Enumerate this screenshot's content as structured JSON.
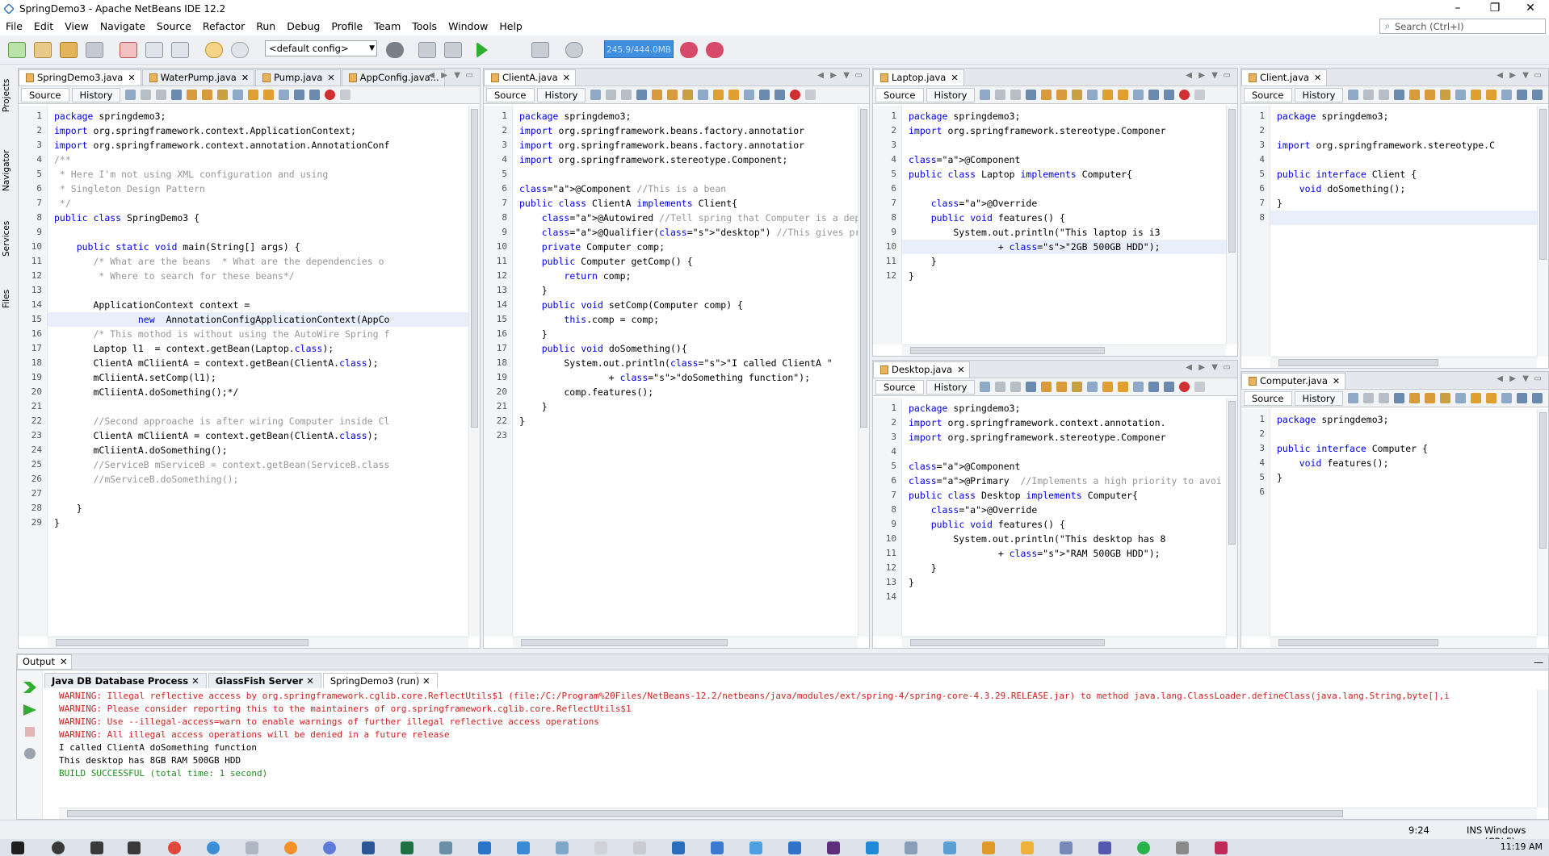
{
  "window": {
    "title": "SpringDemo3 - Apache NetBeans IDE 12.2"
  },
  "menu": [
    "File",
    "Edit",
    "View",
    "Navigate",
    "Source",
    "Refactor",
    "Run",
    "Debug",
    "Profile",
    "Team",
    "Tools",
    "Window",
    "Help"
  ],
  "search": {
    "placeholder": "Search (Ctrl+I)"
  },
  "toolbar": {
    "config": "<default config>",
    "memory": "245.9/444.0MB"
  },
  "side_tabs": [
    "Projects",
    "Navigator",
    "Services",
    "Files"
  ],
  "editor": {
    "source_label": "Source",
    "history_label": "History"
  },
  "panes": {
    "p1": {
      "tabs": [
        "SpringDemo3.java",
        "WaterPump.java",
        "Pump.java",
        "AppConfig.java..."
      ],
      "lines": [
        "1",
        "2",
        "3",
        "4",
        "5",
        "6",
        "7",
        "8",
        "9",
        "10",
        "11",
        "12",
        "13",
        "14",
        "15",
        "16",
        "17",
        "18",
        "19",
        "20",
        "21",
        "22",
        "23",
        "24",
        "25",
        "26",
        "27",
        "28",
        "29"
      ],
      "code": [
        "package springdemo3;",
        "import org.springframework.context.ApplicationContext;",
        "import org.springframework.context.annotation.AnnotationConf",
        "/**",
        " * Here I'm not using XML configuration and using",
        " * Singleton Design Pattern",
        " */",
        "public class SpringDemo3 {",
        "",
        "    public static void main(String[] args) {",
        "       /* What are the beans  * What are the dependencies o",
        "        * Where to search for these beans*/",
        "",
        "       ApplicationContext context =",
        "               new  AnnotationConfigApplicationContext(AppCo",
        "       /* This mothod is without using the AutoWire Spring f",
        "       Laptop l1  = context.getBean(Laptop.class);",
        "       ClientA mCliientA = context.getBean(ClientA.class);",
        "       mCliientA.setComp(l1);",
        "       mCliientA.doSomething();*/",
        "",
        "       //Second approache is after wiring Computer inside Cl",
        "       ClientA mCliientA = context.getBean(ClientA.class);",
        "       mCliientA.doSomething();",
        "       //ServiceB mServiceB = context.getBean(ServiceB.class",
        "       //mServiceB.doSomething();",
        "",
        "    }",
        "}"
      ]
    },
    "p2": {
      "tabs": [
        "ClientA.java"
      ],
      "lines": [
        "1",
        "2",
        "3",
        "4",
        "5",
        "6",
        "7",
        "8",
        "9",
        "10",
        "11",
        "12",
        "13",
        "14",
        "15",
        "16",
        "17",
        "18",
        "19",
        "20",
        "21",
        "22",
        "23"
      ],
      "code": [
        "package springdemo3;",
        "import org.springframework.beans.factory.annotatior",
        "import org.springframework.beans.factory.annotatior",
        "import org.springframework.stereotype.Component;",
        "",
        "@Component //This is a bean",
        "public class ClientA implements Client{",
        "    @Autowired //Tell spring that Computer is a dep",
        "    @Qualifier(\"desktop\") //This gives preferrence",
        "    private Computer comp;",
        "    public Computer getComp() {",
        "        return comp;",
        "    }",
        "    public void setComp(Computer comp) {",
        "        this.comp = comp;",
        "    }",
        "    public void doSomething(){",
        "        System.out.println(\"I called ClientA \"",
        "                + \"doSomething function\");",
        "        comp.features();",
        "    }",
        "}",
        ""
      ]
    },
    "p3": {
      "tabs": [
        "Laptop.java"
      ],
      "lines": [
        "1",
        "2",
        "3",
        "4",
        "5",
        "6",
        "7",
        "8",
        "9",
        "10",
        "11",
        "12"
      ],
      "code": [
        "package springdemo3;",
        "import org.springframework.stereotype.Componer",
        "",
        "@Component",
        "public class Laptop implements Computer{",
        "",
        "    @Override",
        "    public void features() {",
        "        System.out.println(\"This laptop is i3",
        "                + \"2GB 500GB HDD\");",
        "    }",
        "}"
      ]
    },
    "p4": {
      "tabs": [
        "Desktop.java"
      ],
      "lines": [
        "1",
        "2",
        "3",
        "4",
        "5",
        "6",
        "7",
        "8",
        "9",
        "10",
        "11",
        "12",
        "13",
        "14"
      ],
      "code": [
        "package springdemo3;",
        "import org.springframework.context.annotation.",
        "import org.springframework.stereotype.Componer",
        "",
        "@Component",
        "@Primary  //Implements a high priority to avoi",
        "public class Desktop implements Computer{",
        "    @Override",
        "    public void features() {",
        "        System.out.println(\"This desktop has 8",
        "                + \"RAM 500GB HDD\");",
        "    }",
        "}",
        ""
      ]
    },
    "p5": {
      "tabs": [
        "Client.java"
      ],
      "lines": [
        "1",
        "2",
        "3",
        "4",
        "5",
        "6",
        "7",
        "8"
      ],
      "code": [
        "package springdemo3;",
        "",
        "import org.springframework.stereotype.C",
        "",
        "public interface Client {",
        "    void doSomething();",
        "}",
        ""
      ]
    },
    "p6": {
      "tabs": [
        "Computer.java"
      ],
      "lines": [
        "1",
        "2",
        "3",
        "4",
        "5",
        "6"
      ],
      "code": [
        "package springdemo3;",
        "",
        "public interface Computer {",
        "    void features();",
        "}",
        ""
      ]
    }
  },
  "output": {
    "title": "Output",
    "tabs": [
      "Java DB Database Process",
      "GlassFish Server",
      "SpringDemo3 (run)"
    ],
    "lines": [
      "WARNING: Illegal reflective access by org.springframework.cglib.core.ReflectUtils$1 (file:/C:/Program%20Files/NetBeans-12.2/netbeans/java/modules/ext/spring-4/spring-core-4.3.29.RELEASE.jar) to method java.lang.ClassLoader.defineClass(java.lang.String,byte[],i",
      "WARNING: Please consider reporting this to the maintainers of org.springframework.cglib.core.ReflectUtils$1",
      "WARNING: Use --illegal-access=warn to enable warnings of further illegal reflective access operations",
      "WARNING: All illegal access operations will be denied in a future release",
      "I called ClientA doSomething function",
      "This desktop has 8GB RAM 500GB HDD",
      "BUILD SUCCESSFUL (total time: 1 second)"
    ]
  },
  "status": {
    "position": "9:24",
    "mode": "INS",
    "line_ending": "Windows (CRLF)"
  },
  "taskbar": {
    "time": "11:19 AM"
  },
  "colors": {
    "keyword": "#0000e6",
    "comment": "#969696",
    "string": "#ce7b00",
    "annotation": "#1f8b1f",
    "warning": "#d02020",
    "memory_bar": "#3f8fe0"
  }
}
